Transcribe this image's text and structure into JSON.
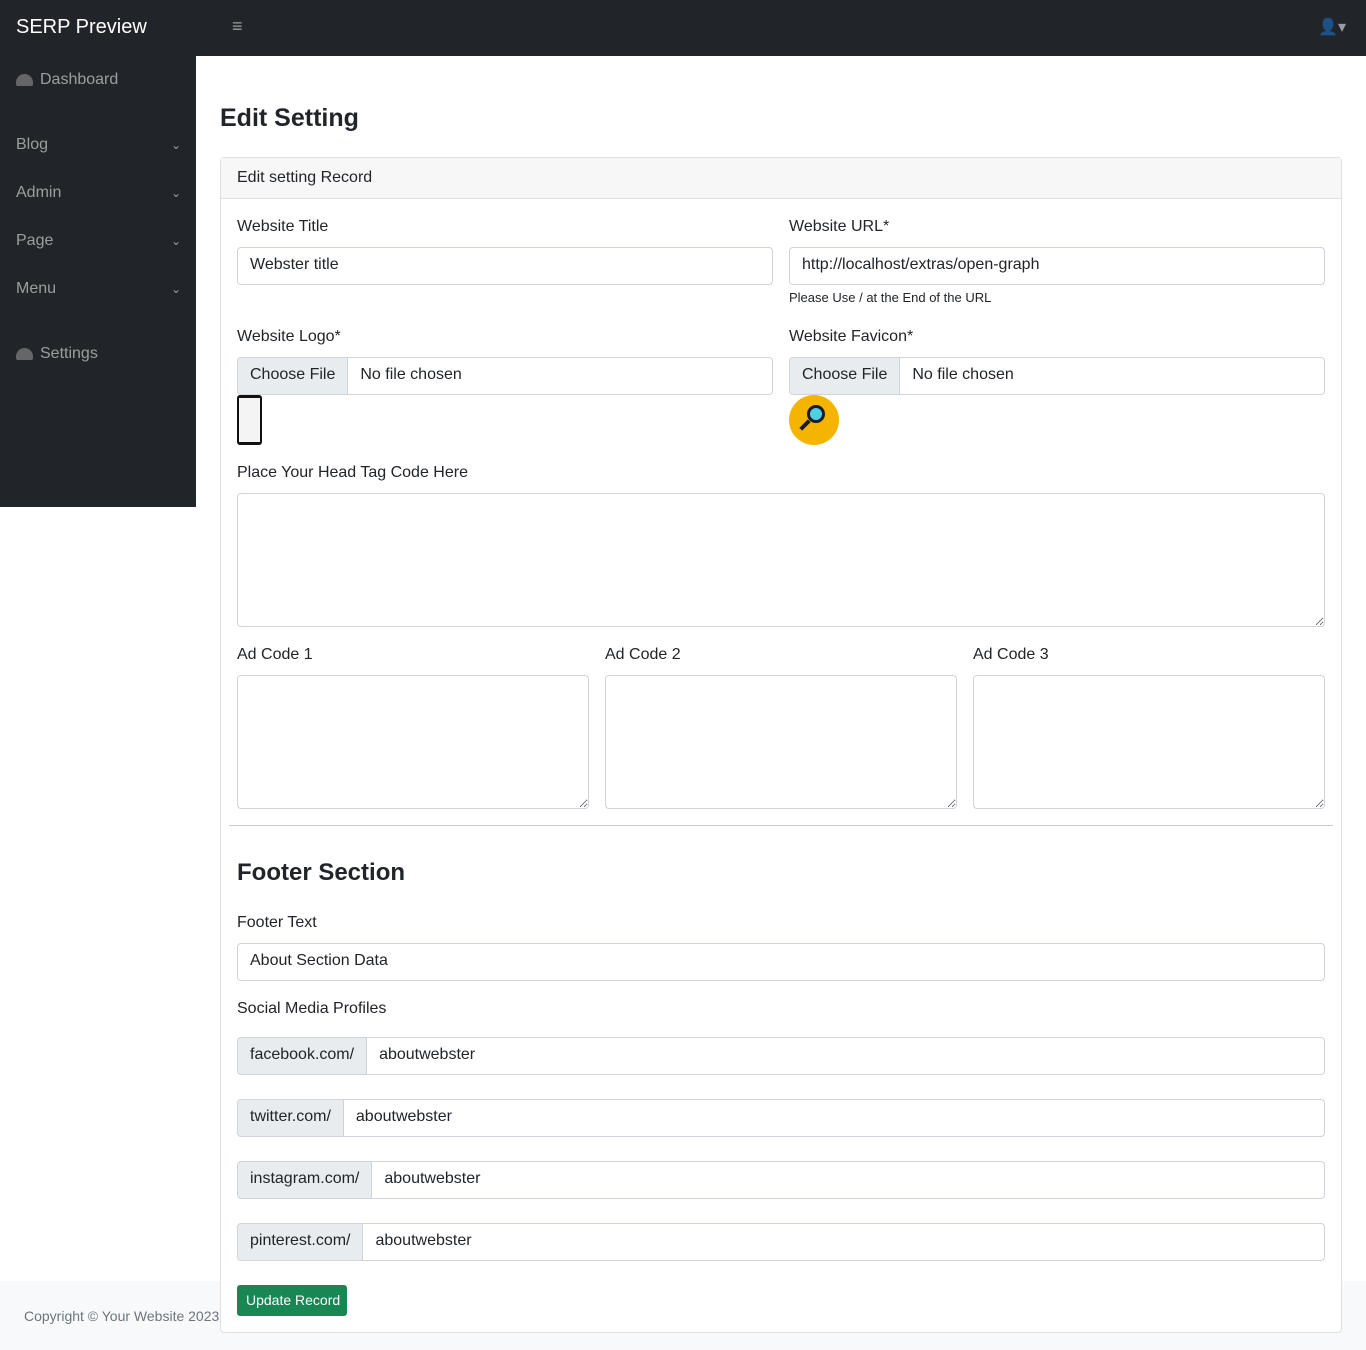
{
  "topbar": {
    "brand": "SERP Preview",
    "toggle_icon": "≡",
    "user_icon": "👤▾"
  },
  "sidebar": {
    "items": [
      {
        "label": "Dashboard"
      },
      {
        "label": "Blog"
      },
      {
        "label": "Admin"
      },
      {
        "label": "Page"
      },
      {
        "label": "Menu"
      },
      {
        "label": "Settings"
      }
    ]
  },
  "page": {
    "title": "Edit Setting",
    "card_header": "Edit setting Record"
  },
  "form": {
    "website_title": {
      "label": "Website Title",
      "value": "Webster title"
    },
    "website_url": {
      "label": "Website URL*",
      "value": "http://localhost/extras/open-graph",
      "help": "Please Use / at the End of the URL"
    },
    "logo": {
      "label": "Website Logo*",
      "button": "Choose File",
      "status": "No file chosen"
    },
    "favicon": {
      "label": "Website Favicon*",
      "button": "Choose File",
      "status": "No file chosen"
    },
    "head_code": {
      "label": "Place Your Head Tag Code Here",
      "value": ""
    },
    "ad1": {
      "label": "Ad Code 1"
    },
    "ad2": {
      "label": "Ad Code 2"
    },
    "ad3": {
      "label": "Ad Code 3"
    },
    "footer_section": "Footer Section",
    "footer_text": {
      "label": "Footer Text",
      "value": "About Section Data"
    },
    "social_label": "Social Media Profiles",
    "social": [
      {
        "prefix": "facebook.com/",
        "value": "aboutwebster"
      },
      {
        "prefix": "twitter.com/",
        "value": "aboutwebster"
      },
      {
        "prefix": "instagram.com/",
        "value": "aboutwebster"
      },
      {
        "prefix": "pinterest.com/",
        "value": "aboutwebster"
      }
    ],
    "submit": "Update Record"
  },
  "footer": {
    "copyright": "Copyright © Your Website 2023"
  },
  "colors": {
    "dark": "#212529",
    "success": "#198754"
  }
}
